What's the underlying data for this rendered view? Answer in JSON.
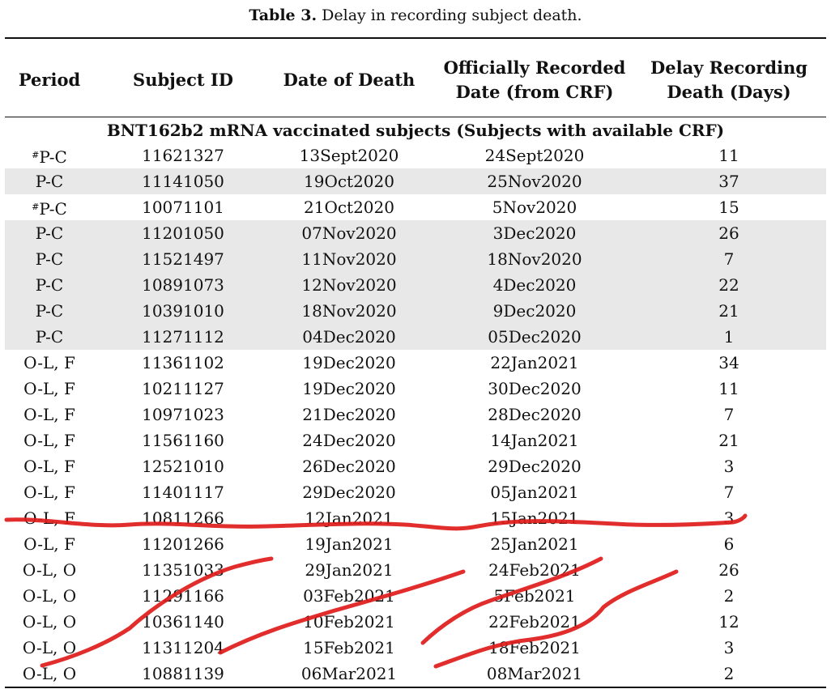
{
  "caption": {
    "label": "Table 3.",
    "text": "Delay in recording subject death."
  },
  "headers": {
    "period": "Period",
    "subject_id": "Subject ID",
    "date_of_death": "Date of Death",
    "recorded": "Officially Recorded Date (from CRF)",
    "delay": "Delay Recording Death (Days)"
  },
  "group_label": "BNT162b2 mRNA vaccinated subjects (Subjects with available CRF)",
  "rows": [
    {
      "mark": "#",
      "period": "P-C",
      "id": "11621327",
      "death": "13Sept2020",
      "recorded": "24Sept2020",
      "delay": "11",
      "shaded": false
    },
    {
      "mark": "",
      "period": "P-C",
      "id": "11141050",
      "death": "19Oct2020",
      "recorded": "25Nov2020",
      "delay": "37",
      "shaded": true
    },
    {
      "mark": "#",
      "period": "P-C",
      "id": "10071101",
      "death": "21Oct2020",
      "recorded": "5Nov2020",
      "delay": "15",
      "shaded": false
    },
    {
      "mark": "",
      "period": "P-C",
      "id": "11201050",
      "death": "07Nov2020",
      "recorded": "3Dec2020",
      "delay": "26",
      "shaded": true
    },
    {
      "mark": "",
      "period": "P-C",
      "id": "11521497",
      "death": "11Nov2020",
      "recorded": "18Nov2020",
      "delay": "7",
      "shaded": true
    },
    {
      "mark": "",
      "period": "P-C",
      "id": "10891073",
      "death": "12Nov2020",
      "recorded": "4Dec2020",
      "delay": "22",
      "shaded": true
    },
    {
      "mark": "",
      "period": "P-C",
      "id": "10391010",
      "death": "18Nov2020",
      "recorded": "9Dec2020",
      "delay": "21",
      "shaded": true
    },
    {
      "mark": "",
      "period": "P-C",
      "id": "11271112",
      "death": "04Dec2020",
      "recorded": "05Dec2020",
      "delay": "1",
      "shaded": true
    },
    {
      "mark": "",
      "period": "O-L, F",
      "id": "11361102",
      "death": "19Dec2020",
      "recorded": "22Jan2021",
      "delay": "34",
      "shaded": false
    },
    {
      "mark": "",
      "period": "O-L, F",
      "id": "10211127",
      "death": "19Dec2020",
      "recorded": "30Dec2020",
      "delay": "11",
      "shaded": false
    },
    {
      "mark": "",
      "period": "O-L, F",
      "id": "10971023",
      "death": "21Dec2020",
      "recorded": "28Dec2020",
      "delay": "7",
      "shaded": false
    },
    {
      "mark": "",
      "period": "O-L, F",
      "id": "11561160",
      "death": "24Dec2020",
      "recorded": "14Jan2021",
      "delay": "21",
      "shaded": false
    },
    {
      "mark": "",
      "period": "O-L, F",
      "id": "12521010",
      "death": "26Dec2020",
      "recorded": "29Dec2020",
      "delay": "3",
      "shaded": false
    },
    {
      "mark": "",
      "period": "O-L, F",
      "id": "11401117",
      "death": "29Dec2020",
      "recorded": "05Jan2021",
      "delay": "7",
      "shaded": false
    },
    {
      "mark": "",
      "period": "O-L, F",
      "id": "10811266",
      "death": "12Jan2021",
      "recorded": "15Jan2021",
      "delay": "3",
      "shaded": false
    },
    {
      "mark": "",
      "period": "O-L, F",
      "id": "11201266",
      "death": "19Jan2021",
      "recorded": "25Jan2021",
      "delay": "6",
      "shaded": false
    },
    {
      "mark": "",
      "period": "O-L, O",
      "id": "11351033",
      "death": "29Jan2021",
      "recorded": "24Feb2021",
      "delay": "26",
      "shaded": false
    },
    {
      "mark": "",
      "period": "O-L, O",
      "id": "11291166",
      "death": "03Feb2021",
      "recorded": "5Feb2021",
      "delay": "2",
      "shaded": false
    },
    {
      "mark": "",
      "period": "O-L, O",
      "id": "10361140",
      "death": "10Feb2021",
      "recorded": "22Feb2021",
      "delay": "12",
      "shaded": false
    },
    {
      "mark": "",
      "period": "O-L, O",
      "id": "11311204",
      "death": "15Feb2021",
      "recorded": "18Feb2021",
      "delay": "3",
      "shaded": false
    },
    {
      "mark": "",
      "period": "O-L, O",
      "id": "10881139",
      "death": "06Mar2021",
      "recorded": "08Mar2021",
      "delay": "2",
      "shaded": false
    }
  ],
  "colors": {
    "shade": "#e8e8e8",
    "annotation": "#e01b1b",
    "rule": "#111111"
  }
}
